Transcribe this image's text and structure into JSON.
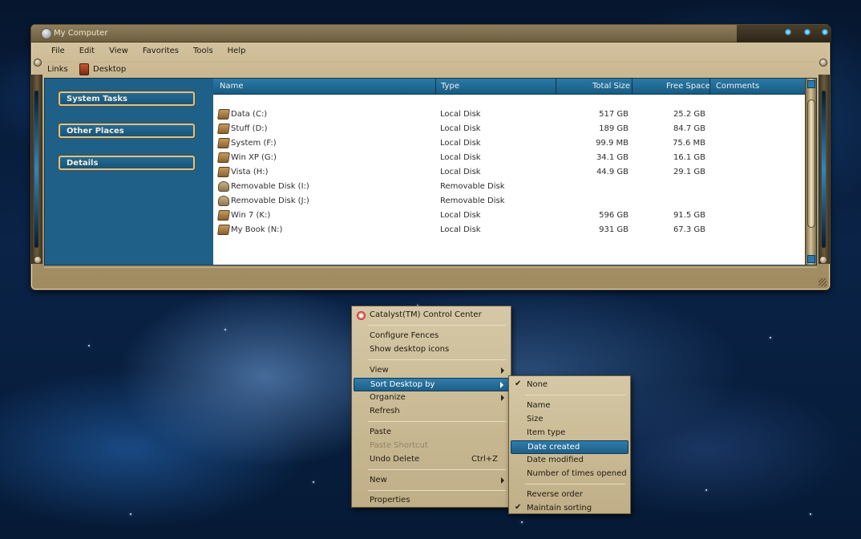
{
  "window": {
    "title": "My Computer",
    "menu": [
      "File",
      "Edit",
      "View",
      "Favorites",
      "Tools",
      "Help"
    ],
    "links_label": "Links",
    "links_item": "Desktop",
    "task_buttons": [
      "System Tasks",
      "Other Places",
      "Details"
    ],
    "columns": [
      "Name",
      "Type",
      "Total Size",
      "Free Space",
      "Comments"
    ],
    "drives": [
      {
        "name": "Data (C:)",
        "type": "Local Disk",
        "total": "517 GB",
        "free": "25.2 GB",
        "icon": "drive-icon"
      },
      {
        "name": "Stuff (D:)",
        "type": "Local Disk",
        "total": "189 GB",
        "free": "84.7 GB",
        "icon": "drive-icon"
      },
      {
        "name": "System  (F:)",
        "type": "Local Disk",
        "total": "99.9 MB",
        "free": "75.6 MB",
        "icon": "drive-icon"
      },
      {
        "name": "Win XP (G:)",
        "type": "Local Disk",
        "total": "34.1 GB",
        "free": "16.1 GB",
        "icon": "drive-icon"
      },
      {
        "name": "Vista (H:)",
        "type": "Local Disk",
        "total": "44.9 GB",
        "free": "29.1 GB",
        "icon": "drive-icon"
      },
      {
        "name": "Removable Disk (I:)",
        "type": "Removable Disk",
        "total": "",
        "free": "",
        "icon": "removable-disk-icon"
      },
      {
        "name": "Removable Disk (J:)",
        "type": "Removable Disk",
        "total": "",
        "free": "",
        "icon": "removable-disk-icon"
      },
      {
        "name": "Win 7 (K:)",
        "type": "Local Disk",
        "total": "596 GB",
        "free": "91.5 GB",
        "icon": "drive-icon"
      },
      {
        "name": "My Book (N:)",
        "type": "Local Disk",
        "total": "931 GB",
        "free": "67.3 GB",
        "icon": "drive-icon"
      }
    ]
  },
  "context_menu": {
    "catalyst": "Catalyst(TM) Control Center",
    "configure_fences": "Configure Fences",
    "show_desktop_icons": "Show desktop icons",
    "view": "View",
    "sort_desktop_by": "Sort Desktop by",
    "organize": "Organize",
    "refresh": "Refresh",
    "paste": "Paste",
    "paste_shortcut": "Paste Shortcut",
    "undo_delete": "Undo Delete",
    "undo_accel": "Ctrl+Z",
    "new": "New",
    "properties": "Properties"
  },
  "sort_submenu": {
    "none": "None",
    "name": "Name",
    "size": "Size",
    "item_type": "Item type",
    "date_created": "Date created",
    "date_modified": "Date modified",
    "times_opened": "Number of times opened",
    "reverse_order": "Reverse order",
    "maintain_sorting": "Maintain sorting"
  },
  "colors": {
    "accent": "#1e5f88",
    "frame": "#bba77d",
    "pane": "#1f6088"
  }
}
